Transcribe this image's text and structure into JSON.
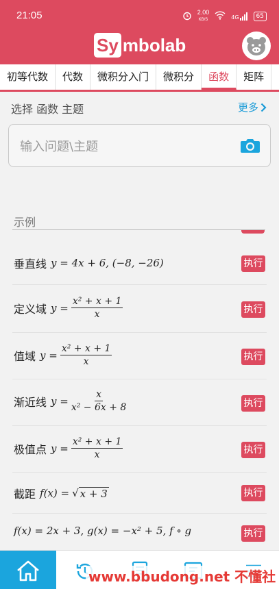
{
  "status_bar": {
    "time": "21:05",
    "net_speed": "2.00",
    "net_unit": "KB/S",
    "signal": "4G",
    "battery": "65"
  },
  "header": {
    "logo_box": "Sy",
    "logo_rest": "mbolab"
  },
  "tabs": [
    {
      "label": "初等代数"
    },
    {
      "label": "代数"
    },
    {
      "label": "微积分入门"
    },
    {
      "label": "微积分"
    },
    {
      "label": "函数"
    },
    {
      "label": "矩阵"
    }
  ],
  "subheader": {
    "title": "选择 函数 主题",
    "more": "更多"
  },
  "search": {
    "placeholder": "输入问题\\主题"
  },
  "examples": {
    "label": "示例",
    "run_label": "执行",
    "rows": [
      {
        "name": "垂直线",
        "formula": "y = 4x + 6,  (−8, −26)"
      },
      {
        "name": "定义域",
        "lhs": "y =",
        "num": "x² + x + 1",
        "den": "x"
      },
      {
        "name": "值域",
        "lhs": "y =",
        "num": "x² + x + 1",
        "den": "x"
      },
      {
        "name": "渐近线",
        "lhs": "y =",
        "num": "x",
        "den": "x² − 6x + 8"
      },
      {
        "name": "极值点",
        "lhs": "y =",
        "num": "x² + x + 1",
        "den": "x"
      },
      {
        "name": "截距",
        "lhs": "f(x) =",
        "radicand": "x + 3"
      },
      {
        "name": "",
        "formula": "f(x) = 2x + 3,  g(x) = −x² + 5,  f ∘ g"
      }
    ]
  },
  "watermark": "www.bbudong.net 不懂社区",
  "colors": {
    "brand": "#dd4a5f",
    "accent": "#1ba5dd",
    "link": "#1a9bd7"
  }
}
